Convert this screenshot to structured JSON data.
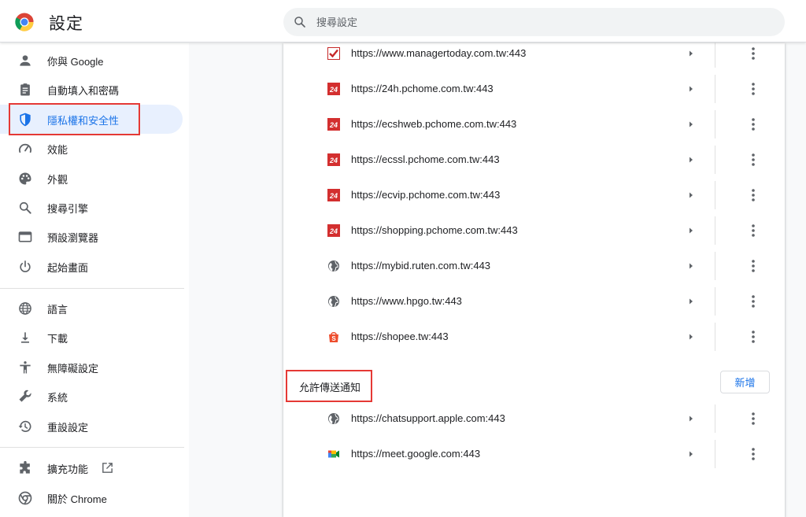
{
  "header": {
    "title": "設定",
    "search_placeholder": "搜尋設定"
  },
  "sidebar": {
    "items": [
      {
        "label": "你與 Google",
        "icon": "person-icon",
        "active": false
      },
      {
        "label": "自動填入和密碼",
        "icon": "clipboard-icon",
        "active": false
      },
      {
        "label": "隱私權和安全性",
        "icon": "shield-icon",
        "active": true
      },
      {
        "label": "效能",
        "icon": "speedometer-icon",
        "active": false
      },
      {
        "label": "外觀",
        "icon": "palette-icon",
        "active": false
      },
      {
        "label": "搜尋引擎",
        "icon": "search-icon",
        "active": false
      },
      {
        "label": "預設瀏覽器",
        "icon": "browser-window-icon",
        "active": false
      },
      {
        "label": "起始畫面",
        "icon": "power-icon",
        "active": false
      },
      {
        "label": "語言",
        "icon": "globe-icon",
        "active": false
      },
      {
        "label": "下載",
        "icon": "download-icon",
        "active": false
      },
      {
        "label": "無障礙設定",
        "icon": "accessibility-icon",
        "active": false
      },
      {
        "label": "系統",
        "icon": "wrench-icon",
        "active": false
      },
      {
        "label": "重設設定",
        "icon": "restore-icon",
        "active": false
      },
      {
        "label": "擴充功能",
        "icon": "puzzle-icon",
        "active": false
      },
      {
        "label": "關於 Chrome",
        "icon": "chrome-icon",
        "active": false
      }
    ]
  },
  "sites_blocked": [
    {
      "url": "https://www.managertoday.com.tw:443",
      "icon": "managertoday-favicon"
    },
    {
      "url": "https://24h.pchome.com.tw:443",
      "icon": "pchome-24-favicon"
    },
    {
      "url": "https://ecshweb.pchome.com.tw:443",
      "icon": "pchome-24-favicon"
    },
    {
      "url": "https://ecssl.pchome.com.tw:443",
      "icon": "pchome-24-favicon"
    },
    {
      "url": "https://ecvip.pchome.com.tw:443",
      "icon": "pchome-24-favicon"
    },
    {
      "url": "https://shopping.pchome.com.tw:443",
      "icon": "pchome-24-favicon"
    },
    {
      "url": "https://mybid.ruten.com.tw:443",
      "icon": "globe-favicon"
    },
    {
      "url": "https://www.hpgo.tw:443",
      "icon": "globe-favicon"
    },
    {
      "url": "https://shopee.tw:443",
      "icon": "shopee-favicon"
    }
  ],
  "allowed_section": {
    "label": "允許傳送通知",
    "add_label": "新增"
  },
  "sites_allowed": [
    {
      "url": "https://chatsupport.apple.com:443",
      "icon": "globe-favicon"
    },
    {
      "url": "https://meet.google.com:443",
      "icon": "google-meet-favicon"
    }
  ],
  "colors": {
    "accent": "#1a73e8",
    "active_bg": "#e8f0fe",
    "highlight_box": "#e53935",
    "pchome_red": "#d32f2f",
    "shopee_orange": "#ee4d2d"
  }
}
